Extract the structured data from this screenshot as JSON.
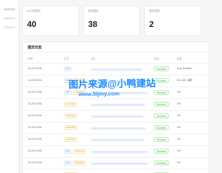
{
  "stats": [
    {
      "label": "24小时提交",
      "value": "40"
    },
    {
      "label": "成功提交",
      "value": "38"
    },
    {
      "label": "提交失败",
      "value": "2"
    }
  ],
  "panel": {
    "title": "提交日志",
    "columns": [
      "时间",
      "方式",
      "URL",
      "状态",
      "信息"
    ]
  },
  "rows": [
    {
      "time": "11-25 03:46",
      "method": [
        "API"
      ],
      "status": "Success",
      "info": "Auto Publish"
    },
    {
      "time": "11-25 03:31",
      "method": [
        "API",
        "IndexNow"
      ],
      "status": "Success",
      "info": "Ex=400, 请求"
    },
    {
      "time": "11-25 03:30",
      "method": [
        "API",
        "IndexNow"
      ],
      "status": "Success",
      "info": "OK"
    },
    {
      "time": "11-25 03:30",
      "method": [
        "IndexNow"
      ],
      "status": "Success",
      "info": "OK"
    },
    {
      "time": "11-25 03:30",
      "method": [
        "IndexNow"
      ],
      "status": "Success",
      "info": "OK"
    },
    {
      "time": "11-25 03:30",
      "method": [
        "IndexNow"
      ],
      "status": "Success",
      "info": "OK"
    },
    {
      "time": "11-25 03:30",
      "method": [
        "IndexNow"
      ],
      "status": "Success",
      "info": "OK"
    },
    {
      "time": "11-25 03:30",
      "method": [
        "API",
        "IndexNow"
      ],
      "status": "Success",
      "info": "OK"
    },
    {
      "time": "11-25 03:30",
      "method": [
        "API",
        "IndexNow"
      ],
      "status": "Success",
      "info": "OK"
    },
    {
      "time": "11-25 03:30",
      "method": [
        "IndexNow"
      ],
      "status": "Success",
      "info": "OK"
    }
  ],
  "watermark": {
    "title": "图片来源@小鸭建站",
    "url": "www.5ljiny.com"
  },
  "colors": {
    "accent": "#1f8cff",
    "success": "#44a644",
    "panel": "#ffffff",
    "background": "#f5f6f8"
  }
}
